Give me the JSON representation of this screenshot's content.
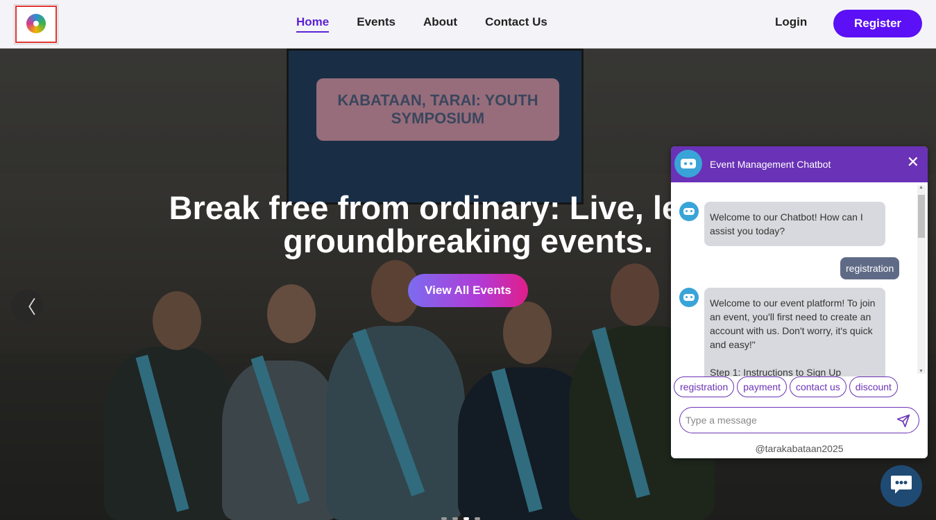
{
  "nav": {
    "links": [
      "Home",
      "Events",
      "About",
      "Contact Us"
    ],
    "login": "Login",
    "register": "Register"
  },
  "hero": {
    "title_line1": "Break free from ordinary: Live, learn, a",
    "title_line2": "groundbreaking events.",
    "button": "View All Events",
    "prev_icon": "〈",
    "screen_text": "KABATAAN, TARAI: YOUTH SYMPOSIUM"
  },
  "chat": {
    "title": "Event Management Chatbot",
    "close_icon": "✕",
    "messages": [
      {
        "from": "bot",
        "text": "Welcome to our Chatbot! How can I assist you today?"
      },
      {
        "from": "user",
        "text": "registration"
      },
      {
        "from": "bot",
        "text": "Welcome to our event platform! To join an event, you'll first need to create an account with us. Don't worry, it's quick and easy!\"\n\nStep 1: Instructions to Sign Up"
      }
    ],
    "quick_replies": [
      "registration",
      "payment",
      "contact us",
      "discount"
    ],
    "input_placeholder": "Type a message",
    "footer": "@tarakabataan2025"
  },
  "colors": {
    "accent": "#5b10f5",
    "chat_header": "#6a32b6",
    "bot_avatar": "#39a4d8",
    "fab": "#1e4a73"
  }
}
